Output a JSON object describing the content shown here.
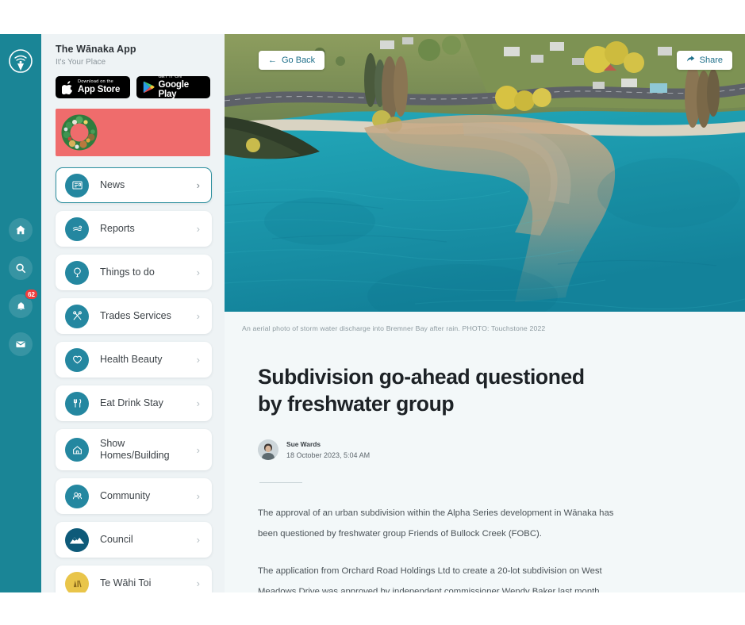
{
  "rail": {
    "logo_icon": "wanaka-app-logo-icon",
    "items": [
      {
        "icon": "home-icon",
        "name": "home"
      },
      {
        "icon": "search-icon",
        "name": "search"
      },
      {
        "icon": "bell-icon",
        "name": "notifications",
        "badge": "62"
      },
      {
        "icon": "mail-icon",
        "name": "messages"
      }
    ]
  },
  "sidebar": {
    "brand_title": "The Wānaka App",
    "brand_sub": "It's Your Place",
    "store_badges": [
      {
        "icon": "apple-icon",
        "small": "Download on the",
        "big": "App Store"
      },
      {
        "icon": "google-play-icon",
        "small": "GET IT ON",
        "big": "Google Play"
      }
    ],
    "promo": {
      "name": "christmas-wreath-banner",
      "bg": "#ef6c6c"
    },
    "menu": [
      {
        "label": "News",
        "icon": "newspaper-icon",
        "active": true
      },
      {
        "label": "Reports",
        "icon": "weather-icon",
        "active": false
      },
      {
        "label": "Things to do",
        "icon": "balloon-icon",
        "active": false
      },
      {
        "label": "Trades Services",
        "icon": "tools-icon",
        "active": false
      },
      {
        "label": "Health Beauty",
        "icon": "heart-icon",
        "active": false
      },
      {
        "label": "Eat Drink Stay",
        "icon": "cutlery-icon",
        "active": false
      },
      {
        "label": "Show Homes/Building",
        "icon": "house-icon",
        "active": false
      },
      {
        "label": "Community",
        "icon": "people-icon",
        "active": false
      },
      {
        "label": "Council",
        "icon": "mountain-icon",
        "active": false
      },
      {
        "label": "Te Wāhi Toi",
        "icon": "art-coin-icon",
        "active": false
      }
    ]
  },
  "main": {
    "go_back_label": "Go Back",
    "share_label": "Share",
    "caption": "An aerial photo of storm water discharge into Bremner Bay after rain. PHOTO: Touchstone 2022",
    "headline": "Subdivision go-ahead questioned by freshwater group",
    "author_name": "Sue Wards",
    "published": "18 October 2023, 5:04 AM",
    "paragraphs": [
      "The approval of an urban subdivision within the Alpha Series development in Wānaka has been questioned by freshwater group Friends of Bullock Creek (FOBC).",
      "The application from Orchard Road Holdings Ltd to create a 20-lot subdivision on West Meadows Drive was approved by independent commissioner Wendy Baker last month."
    ]
  },
  "colors": {
    "rail_teal": "#1a8596",
    "icon_teal": "#2487a0",
    "sidebar_bg": "#eef3f5",
    "content_bg": "#f3f8f9",
    "promo_red": "#ef6c6c",
    "badge_red": "#ef3d3d",
    "link_blue": "#1e6f8a"
  }
}
